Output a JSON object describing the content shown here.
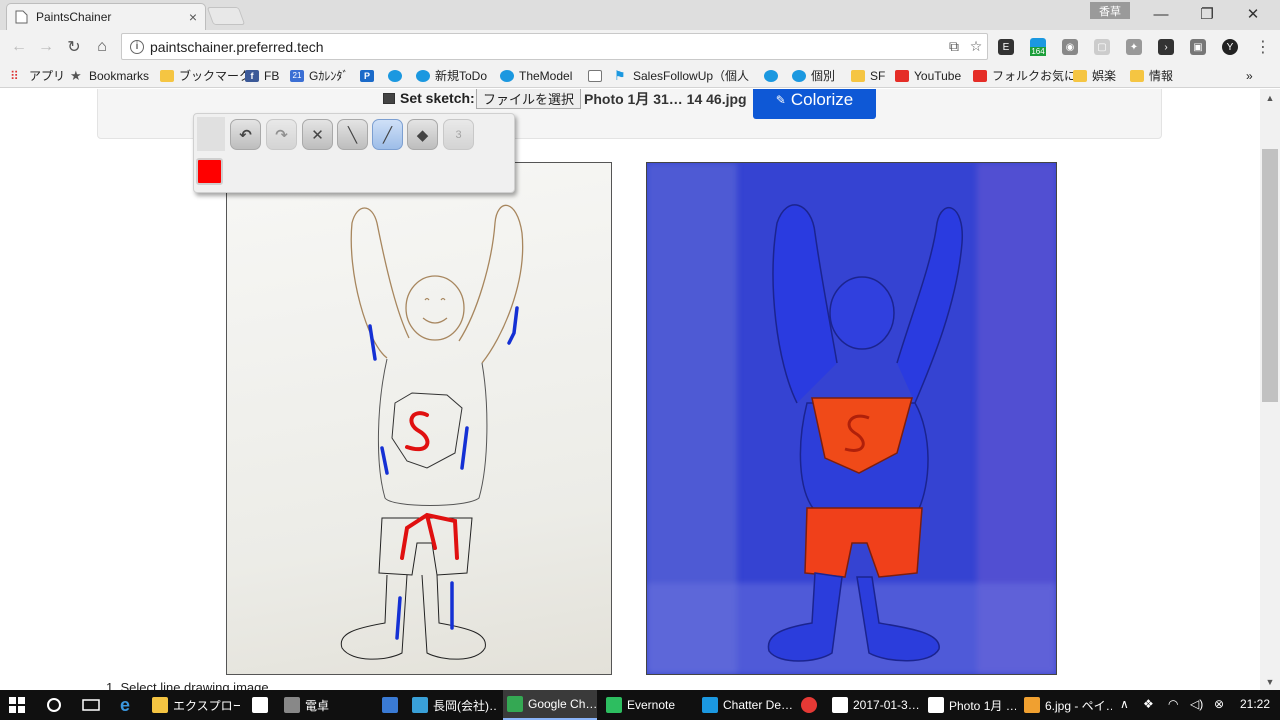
{
  "browser": {
    "tab_title": "PaintsChainer",
    "tab_close": "×",
    "ime_indicator": "香草",
    "window_controls": {
      "minimize": "—",
      "maximize": "❐",
      "close": "✕"
    },
    "url": "paintschainer.preferred.tech",
    "extension_badge": "164"
  },
  "bookmarks": [
    {
      "label": "アプリ",
      "icon": "apps-icon"
    },
    {
      "label": "Bookmarks",
      "icon": "star-icon"
    },
    {
      "label": "ブックマーク",
      "icon": "folder-icon"
    },
    {
      "label": "FB",
      "icon": "facebook-icon"
    },
    {
      "label": "Gｶﾚﾝﾀﾞ",
      "icon": "calendar-icon"
    },
    {
      "label": "",
      "icon": "p-icon"
    },
    {
      "label": "",
      "icon": "salesforce-icon"
    },
    {
      "label": "新規ToDo",
      "icon": "salesforce-icon"
    },
    {
      "label": "TheModel",
      "icon": "salesforce-icon"
    },
    {
      "label": "",
      "icon": "page-icon"
    },
    {
      "label": "SalesFollowUp（個人",
      "icon": "runner-icon"
    },
    {
      "label": "",
      "icon": "salesforce-icon"
    },
    {
      "label": "個別",
      "icon": "salesforce-icon"
    },
    {
      "label": "SF",
      "icon": "folder-icon"
    },
    {
      "label": "YouTube",
      "icon": "youtube-icon"
    },
    {
      "label": "フォルクお気に",
      "icon": "youtube-icon"
    },
    {
      "label": "娯楽",
      "icon": "folder-icon"
    },
    {
      "label": "情報",
      "icon": "folder-icon"
    }
  ],
  "bookmarks_more": "»",
  "page": {
    "set_sketch_label": "Set sketch:",
    "file_button": "ファイルを選択",
    "file_name": "Photo 1月 31… 14 46.jpg",
    "colorize_label": "Colorize",
    "colorize_icon": "✎",
    "select_line_text": "1. Select line drawing image"
  },
  "palette": {
    "tools": [
      {
        "name": "undo-tool",
        "glyph": "↶",
        "state": "normal"
      },
      {
        "name": "redo-tool",
        "glyph": "↷",
        "state": "disabled"
      },
      {
        "name": "clear-tool",
        "glyph": "✕",
        "state": "normal"
      },
      {
        "name": "line-tool",
        "glyph": "╲",
        "state": "normal"
      },
      {
        "name": "pen-tool",
        "glyph": "╱",
        "state": "active"
      },
      {
        "name": "eraser-tool",
        "glyph": "◆",
        "state": "normal"
      },
      {
        "name": "size-tool",
        "glyph": "3",
        "state": "disabled"
      }
    ],
    "current_color": "#ff0000"
  },
  "taskbar": {
    "items": [
      {
        "label": "エクスプロー…",
        "icon": "explorer-icon",
        "active": false
      },
      {
        "label": "",
        "icon": "store-icon",
        "active": false
      },
      {
        "label": "電卓",
        "icon": "calculator-icon",
        "active": false
      },
      {
        "label": "",
        "icon": "mail-icon",
        "active": false
      },
      {
        "label": "長岡(会社)…",
        "icon": "chat-icon",
        "active": false
      },
      {
        "label": "Google Ch…",
        "icon": "chrome-icon",
        "active": true
      },
      {
        "label": "Evernote",
        "icon": "evernote-icon",
        "active": false
      },
      {
        "label": "Chatter De…",
        "icon": "chatter-icon",
        "active": false
      },
      {
        "label": "",
        "icon": "tomato-icon",
        "active": false
      },
      {
        "label": "2017-01-3…",
        "icon": "photo-icon",
        "active": false
      },
      {
        "label": "Photo 1月 …",
        "icon": "photo-icon",
        "active": false
      },
      {
        "label": "6.jpg - ペイ…",
        "icon": "paint-icon",
        "active": false
      }
    ],
    "clock": "21:22"
  },
  "colors": {
    "accent": "#0e58d6",
    "chrome_bg": "#f2f2f2",
    "taskbar_bg": "#101010"
  }
}
